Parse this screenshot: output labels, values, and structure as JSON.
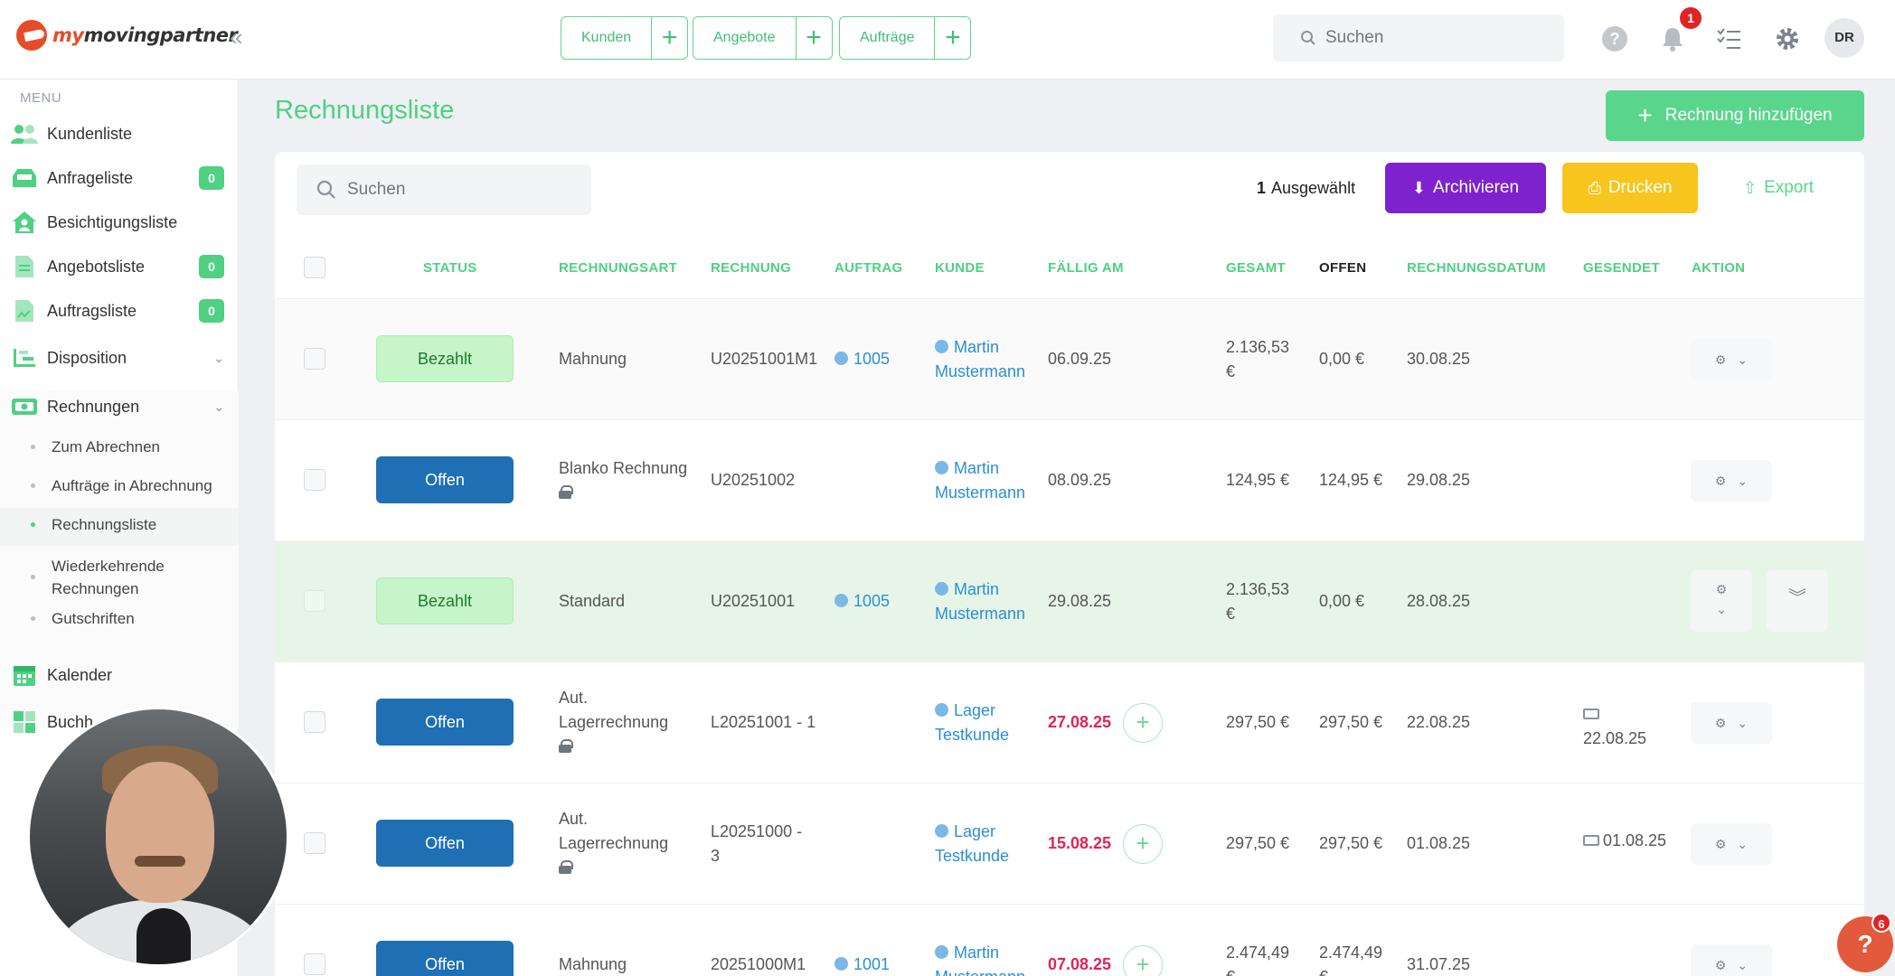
{
  "brand": {
    "name_prefix": "my",
    "name_main": "movingpartner"
  },
  "quick_actions": [
    {
      "label": "Kunden"
    },
    {
      "label": "Angebote"
    },
    {
      "label": "Aufträge"
    }
  ],
  "topbar": {
    "search_placeholder": "Suchen",
    "help_label": "?",
    "notification_count": "1",
    "avatar_initials": "DR"
  },
  "sidebar": {
    "menu_heading": "MENU",
    "items": [
      {
        "label": "Kundenliste",
        "icon": "users-icon"
      },
      {
        "label": "Anfrageliste",
        "icon": "inbox-icon",
        "badge": "0"
      },
      {
        "label": "Besichtigungsliste",
        "icon": "home-user-icon"
      },
      {
        "label": "Angebotsliste",
        "icon": "document-icon",
        "badge": "0"
      },
      {
        "label": "Auftragsliste",
        "icon": "file-signature-icon",
        "badge": "0"
      },
      {
        "label": "Disposition",
        "icon": "gantt-icon"
      },
      {
        "label": "Rechnungen",
        "icon": "money-icon"
      },
      {
        "label": "Kalender",
        "icon": "calendar-icon"
      },
      {
        "label": "Buchh",
        "icon": "calculator-icon"
      }
    ],
    "rechnungen_sub": [
      {
        "label": "Zum Abrechnen"
      },
      {
        "label": "Aufträge in Abrechnung"
      },
      {
        "label": "Rechnungsliste"
      },
      {
        "label": "Wiederkehrende Rechnungen"
      },
      {
        "label": "Gutschriften"
      }
    ]
  },
  "page": {
    "title": "Rechnungsliste",
    "add_button": "Rechnung hinzufügen"
  },
  "toolbar": {
    "search_placeholder": "Suchen",
    "selected_count": "1",
    "selected_label": "Ausgewählt",
    "archive_label": "Archivieren",
    "print_label": "Drucken",
    "export_label": "Export"
  },
  "table": {
    "columns": [
      "STATUS",
      "RECHNUNGSART",
      "RECHNUNG",
      "AUFTRAG",
      "KUNDE",
      "FÄLLIG AM",
      "GESAMT",
      "OFFEN",
      "RECHNUNGSDATUM",
      "GESENDET",
      "AKTION"
    ],
    "rows": [
      {
        "status": "Bezahlt",
        "art": "Mahnung",
        "rechnung": "U20251001M1",
        "auftrag": "1005",
        "kunde_1": "Martin",
        "kunde_2": "Mustermann",
        "faellig": "06.09.25",
        "gesamt_1": "2.136,53",
        "gesamt_2": "€",
        "offen": "0,00 €",
        "datum": "30.08.25",
        "gesendet": ""
      },
      {
        "status": "Offen",
        "art": "Blanko Rechnung",
        "rechnung": "U20251002",
        "auftrag": "",
        "kunde_1": "Martin",
        "kunde_2": "Mustermann",
        "faellig": "08.09.25",
        "gesamt_1": "124,95 €",
        "gesamt_2": "",
        "offen": "124,95 €",
        "datum": "29.08.25",
        "gesendet": ""
      },
      {
        "status": "Bezahlt",
        "art": "Standard",
        "rechnung": "U20251001",
        "auftrag": "1005",
        "kunde_1": "Martin",
        "kunde_2": "Mustermann",
        "faellig": "29.08.25",
        "gesamt_1": "2.136,53",
        "gesamt_2": "€",
        "offen": "0,00 €",
        "datum": "28.08.25",
        "gesendet": ""
      },
      {
        "status": "Offen",
        "art_1": "Aut.",
        "art_2": "Lagerrechnung",
        "rechnung": "L20251001 - 1",
        "auftrag": "",
        "kunde_1": "Lager",
        "kunde_2": "Testkunde",
        "faellig": "27.08.25",
        "gesamt_1": "297,50 €",
        "gesamt_2": "",
        "offen": "297,50 €",
        "datum": "22.08.25",
        "gesendet": "22.08.25"
      },
      {
        "status": "Offen",
        "art_1": "Aut.",
        "art_2": "Lagerrechnung",
        "rechnung_1": "L20251000 -",
        "rechnung_2": "3",
        "auftrag": "",
        "kunde_1": "Lager",
        "kunde_2": "Testkunde",
        "faellig": "15.08.25",
        "gesamt_1": "297,50 €",
        "gesamt_2": "",
        "offen": "297,50 €",
        "datum": "01.08.25",
        "gesendet": "01.08.25"
      },
      {
        "status": "Offen",
        "art": "Mahnung",
        "rechnung": "20251000M1",
        "auftrag": "1001",
        "kunde_1": "Martin",
        "kunde_2": "Mustermann",
        "faellig": "07.08.25",
        "gesamt_1": "2.474,49",
        "gesamt_2": "€",
        "offen_1": "2.474,49",
        "offen_2": "€",
        "datum": "31.07.25",
        "gesendet": ""
      }
    ]
  },
  "help_fab": {
    "label": "?",
    "badge": "6"
  },
  "colors": {
    "accent": "#4fd083",
    "paid": "#c5f5c8",
    "open": "#1f6fb5",
    "archive": "#7e22ce",
    "print": "#f7c51e",
    "overdue": "#e02455"
  }
}
